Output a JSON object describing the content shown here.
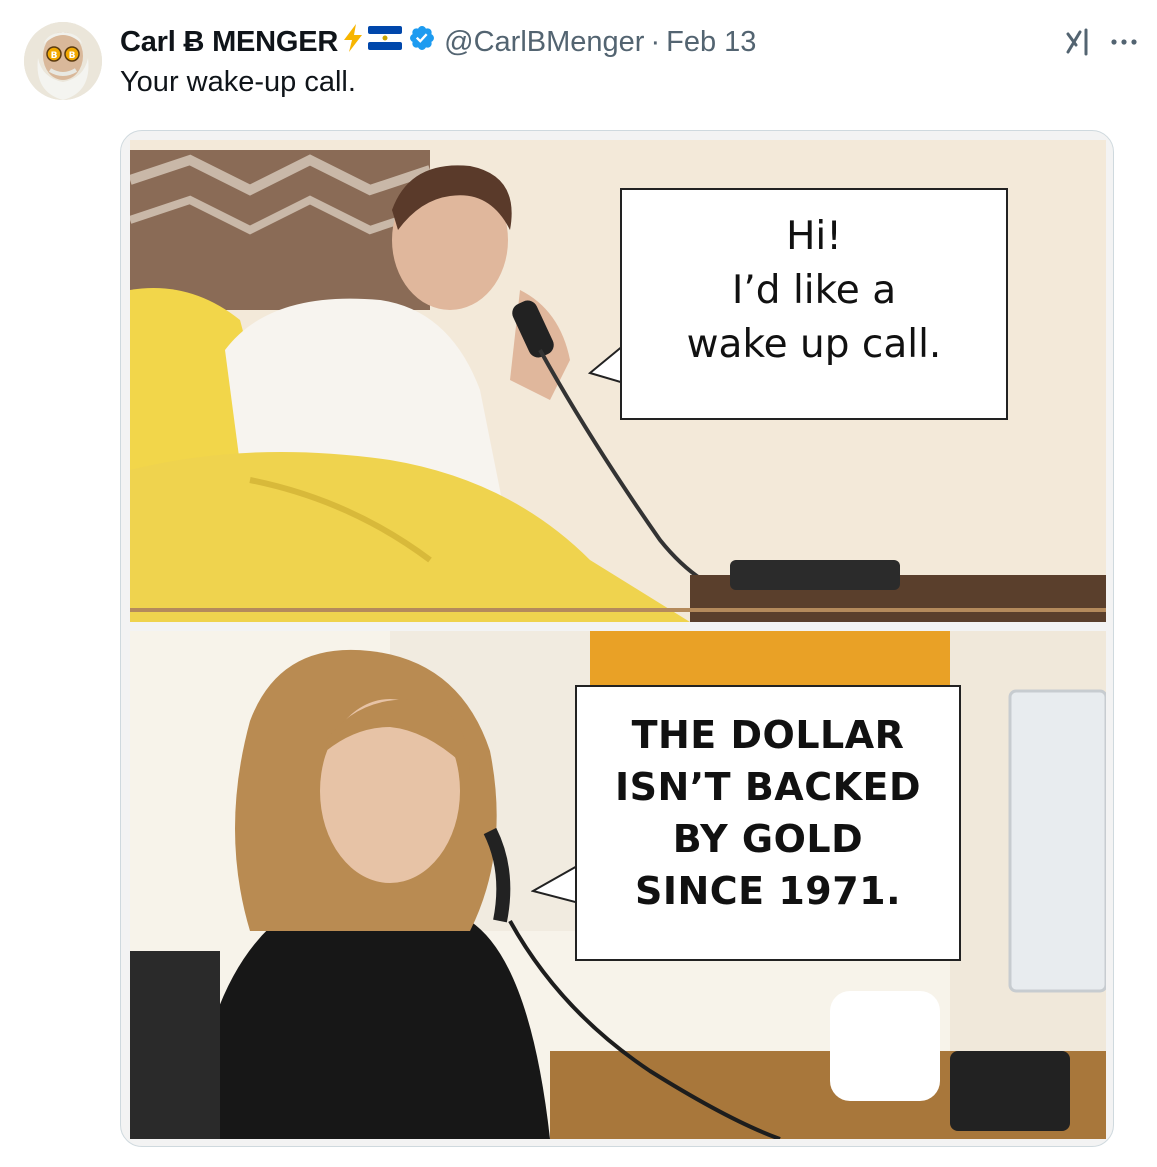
{
  "tweet": {
    "display_name": "Carl Ƀ MENGER",
    "handle": "@CarlBMenger",
    "separator": "·",
    "date": "Feb 13",
    "text": "Your wake-up call."
  },
  "icons": {
    "bolt": "lightning-icon",
    "flag": "el-salvador-flag-icon",
    "verified": "verified-badge-icon",
    "grok": "grok-icon",
    "more": "more-icon"
  },
  "colors": {
    "verified": "#1d9bf0",
    "bolt": "#f7b500",
    "flag_blue": "#0047ab",
    "secondary_text": "#536471"
  },
  "meme": {
    "top_bubble": [
      "Hi!",
      "I’d like a",
      "wake up call."
    ],
    "bottom_bubble": [
      "THE DOLLAR",
      "ISN’T BACKED",
      "BY GOLD",
      "SINCE 1971."
    ]
  }
}
